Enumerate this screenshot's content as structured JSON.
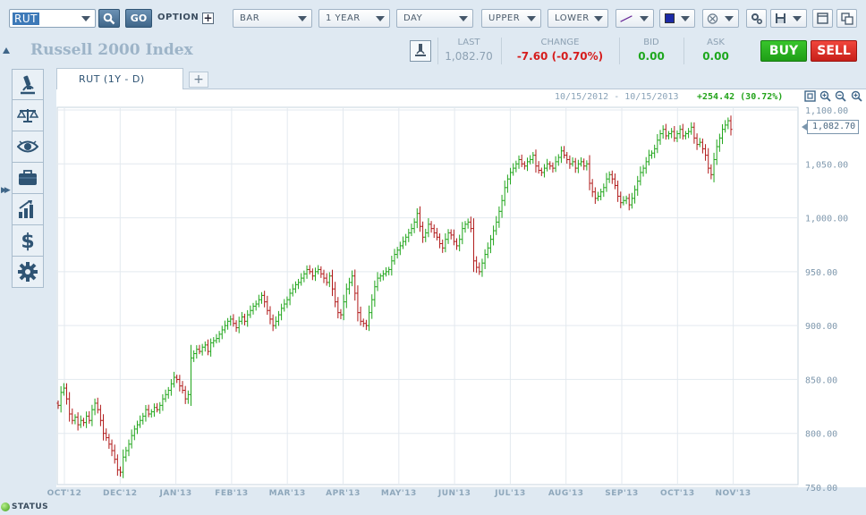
{
  "toolbar": {
    "symbol_value": "RUT",
    "go_label": "GO",
    "option_label": "OPTION",
    "chart_type": "BAR",
    "period": "1 YEAR",
    "interval": "DAY",
    "upper": "UPPER",
    "lower": "LOWER",
    "icons": [
      "search-icon",
      "plus-icon",
      "draw-line-icon",
      "color-icon",
      "crosshair-icon",
      "settings-icon",
      "save-icon",
      "window-icon",
      "multi-window-icon"
    ],
    "color_swatch": "#1c2aa6"
  },
  "header": {
    "title": "Russell 2000 Index",
    "last_label": "LAST",
    "last_value": "1,082.70",
    "change_label": "CHANGE",
    "change_value": "-7.60 (-0.70%)",
    "bid_label": "BID",
    "bid_value": "0.00",
    "ask_label": "ASK",
    "ask_value": "0.00",
    "buy_label": "BUY",
    "sell_label": "SELL"
  },
  "colors": {
    "negative": "#d61d1d",
    "positive": "#1ea71e",
    "buy": "#1f9e17",
    "sell": "#d8261d",
    "up_bar": "#1fa51a",
    "down_bar": "#b01818"
  },
  "sidenav": {
    "items": [
      "microscope-icon",
      "scale-icon",
      "eye-icon",
      "briefcase-icon",
      "bar-growth-icon",
      "dollar-icon",
      "gear-icon"
    ]
  },
  "tabs": [
    {
      "label": "RUT (1Y - D)"
    }
  ],
  "chart_info": {
    "range": "10/15/2012 - 10/15/2013",
    "performance": "+254.42 (30.72%)",
    "last_badge": "1,082.70"
  },
  "status_label": "STATUS",
  "chart_data": {
    "type": "bar",
    "subtype": "ohlc",
    "x_ticks": [
      "OCT'12",
      "DEC'12",
      "JAN'13",
      "FEB'13",
      "MAR'13",
      "APR'13",
      "MAY'13",
      "JUN'13",
      "JUL'13",
      "AUG'13",
      "SEP'13",
      "OCT'13",
      "NOV'13"
    ],
    "y_ticks": [
      "1,100.00",
      "1,050.00",
      "1,000.00",
      "950.00",
      "900.00",
      "850.00",
      "800.00",
      "750.00"
    ],
    "ylim": [
      750,
      1100
    ],
    "grid": true,
    "closes": [
      826,
      838,
      842,
      832,
      818,
      812,
      815,
      808,
      812,
      810,
      816,
      812,
      822,
      828,
      822,
      812,
      800,
      796,
      790,
      784,
      776,
      766,
      764,
      778,
      784,
      790,
      798,
      804,
      808,
      812,
      816,
      822,
      818,
      820,
      824,
      822,
      826,
      832,
      836,
      840,
      846,
      852,
      850,
      844,
      840,
      832,
      836,
      870,
      874,
      878,
      876,
      880,
      882,
      876,
      884,
      886,
      888,
      892,
      896,
      900,
      904,
      906,
      902,
      898,
      904,
      908,
      904,
      910,
      914,
      918,
      920,
      924,
      928,
      922,
      914,
      906,
      900,
      904,
      910,
      916,
      920,
      924,
      930,
      934,
      938,
      940,
      944,
      948,
      952,
      950,
      946,
      950,
      952,
      948,
      944,
      940,
      946,
      934,
      922,
      912,
      910,
      922,
      934,
      940,
      946,
      930,
      912,
      904,
      902,
      900,
      912,
      924,
      936,
      944,
      946,
      948,
      950,
      952,
      960,
      966,
      970,
      974,
      978,
      982,
      986,
      990,
      996,
      1004,
      992,
      982,
      986,
      994,
      990,
      986,
      982,
      976,
      972,
      980,
      986,
      984,
      978,
      974,
      980,
      990,
      994,
      996,
      990,
      960,
      954,
      950,
      958,
      966,
      972,
      980,
      988,
      996,
      1006,
      1016,
      1028,
      1036,
      1042,
      1046,
      1050,
      1054,
      1050,
      1048,
      1052,
      1054,
      1058,
      1048,
      1044,
      1042,
      1046,
      1050,
      1048,
      1046,
      1052,
      1056,
      1062,
      1058,
      1054,
      1050,
      1052,
      1046,
      1050,
      1052,
      1048,
      1050,
      1032,
      1024,
      1018,
      1020,
      1024,
      1028,
      1036,
      1040,
      1036,
      1030,
      1020,
      1014,
      1016,
      1018,
      1012,
      1018,
      1026,
      1034,
      1042,
      1046,
      1052,
      1058,
      1060,
      1064,
      1072,
      1078,
      1082,
      1076,
      1078,
      1080,
      1074,
      1078,
      1082,
      1076,
      1078,
      1080,
      1084,
      1074,
      1068,
      1070,
      1064,
      1058,
      1046,
      1040,
      1054,
      1066,
      1074,
      1082,
      1086,
      1090,
      1082
    ]
  }
}
